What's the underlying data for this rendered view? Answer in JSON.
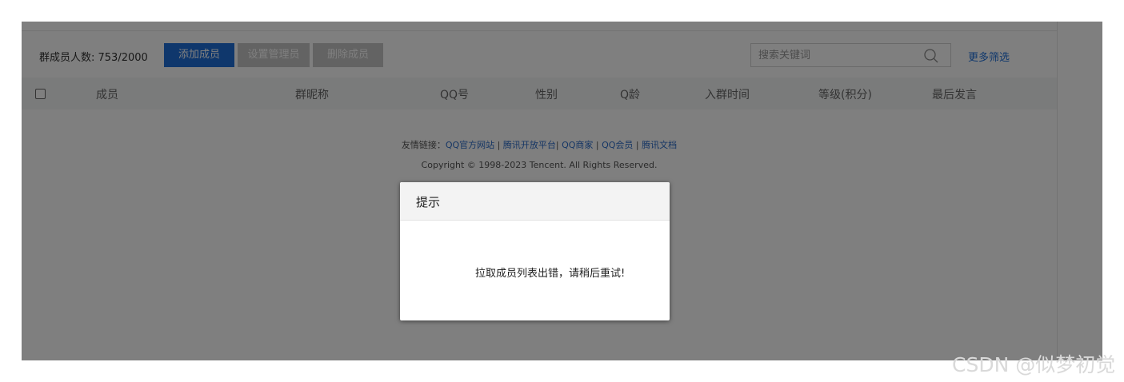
{
  "toolbar": {
    "member_count": "群成员人数: 753/2000",
    "add_label": "添加成员",
    "set_admin_label": "设置管理员",
    "delete_label": "删除成员",
    "search_placeholder": "搜索关键词",
    "more_filter_label": "更多筛选",
    "search_icon": "search-icon"
  },
  "table": {
    "columns": [
      "成员",
      "群昵称",
      "QQ号",
      "性别",
      "Q龄",
      "入群时间",
      "等级(积分)",
      "最后发言"
    ]
  },
  "footer": {
    "links_prefix": "友情链接：",
    "links": [
      "QQ官方网站",
      "腾讯开放平台",
      "QQ商家",
      "QQ会员",
      "腾讯文档"
    ],
    "separators": [
      " | ",
      "| ",
      " | ",
      " | "
    ],
    "copyright": "Copyright © 1998-2023 Tencent. All Rights Reserved."
  },
  "dialog": {
    "title": "提示",
    "message": "拉取成员列表出错，请稍后重试!"
  },
  "watermark": "CSDN @似梦初觉",
  "colors": {
    "accent": "#1e6fd9",
    "disabled_button": "#c6c6c6",
    "overlay": "rgba(0,0,0,0.5)"
  }
}
